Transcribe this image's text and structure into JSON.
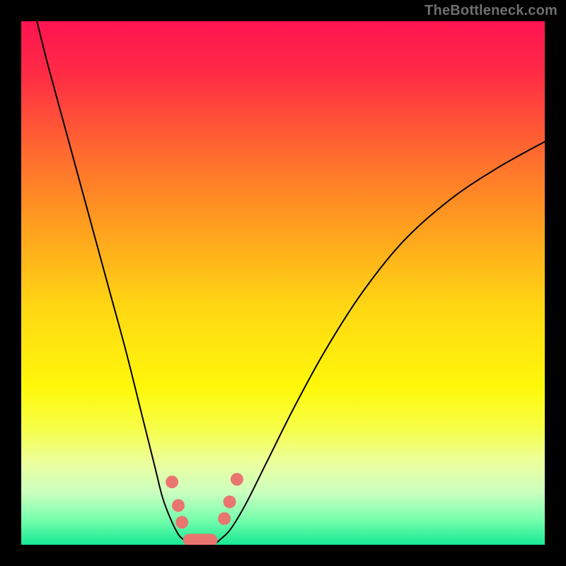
{
  "watermark": "TheBottleneck.com",
  "chart_data": {
    "type": "line",
    "title": "",
    "xlabel": "",
    "ylabel": "",
    "xlim": [
      0,
      100
    ],
    "ylim": [
      0,
      100
    ],
    "grid": false,
    "legend": false,
    "background_gradient": {
      "type": "vertical",
      "stops": [
        {
          "pos": 0.0,
          "color": "#ff1450"
        },
        {
          "pos": 0.1,
          "color": "#ff2b45"
        },
        {
          "pos": 0.25,
          "color": "#ff6a2f"
        },
        {
          "pos": 0.4,
          "color": "#ffa21e"
        },
        {
          "pos": 0.55,
          "color": "#ffd813"
        },
        {
          "pos": 0.7,
          "color": "#fff80a"
        },
        {
          "pos": 0.78,
          "color": "#f6ff4a"
        },
        {
          "pos": 0.84,
          "color": "#edff9b"
        },
        {
          "pos": 0.9,
          "color": "#ccffc0"
        },
        {
          "pos": 0.95,
          "color": "#7affae"
        },
        {
          "pos": 1.0,
          "color": "#18e893"
        }
      ]
    },
    "series": [
      {
        "name": "left-branch",
        "color": "#000000",
        "width": 2.0,
        "x": [
          3,
          5,
          8,
          11,
          14,
          17,
          20,
          23,
          25.5,
          27,
          28.5,
          30,
          31
        ],
        "y": [
          100,
          92,
          81,
          70,
          59,
          48,
          37,
          25,
          15,
          9,
          5,
          2,
          1
        ]
      },
      {
        "name": "right-branch",
        "color": "#000000",
        "width": 2.0,
        "x": [
          38,
          40,
          43,
          47,
          52,
          58,
          65,
          73,
          82,
          91,
          100
        ],
        "y": [
          1,
          3,
          8,
          16,
          26,
          37,
          48,
          58,
          66,
          72,
          77
        ]
      },
      {
        "name": "valley-floor",
        "color": "#000000",
        "width": 2.0,
        "x": [
          31,
          33,
          35,
          37,
          38
        ],
        "y": [
          1,
          0.3,
          0.3,
          0.3,
          1
        ]
      }
    ],
    "marker_series": [
      {
        "name": "left-cluster",
        "color": "#e8766e",
        "radius": 9,
        "points": [
          {
            "x": 28.8,
            "y": 12.0
          },
          {
            "x": 30.0,
            "y": 7.5
          },
          {
            "x": 30.7,
            "y": 4.3
          }
        ]
      },
      {
        "name": "right-cluster",
        "color": "#e8766e",
        "radius": 9,
        "points": [
          {
            "x": 38.8,
            "y": 5.0
          },
          {
            "x": 39.8,
            "y": 8.2
          },
          {
            "x": 41.2,
            "y": 12.5
          }
        ]
      },
      {
        "name": "bottom-oval",
        "color": "#e8766e",
        "kind": "capsule",
        "cx": 34.2,
        "cy": 0.9,
        "half_w": 3.3,
        "half_h": 1.2
      }
    ]
  }
}
